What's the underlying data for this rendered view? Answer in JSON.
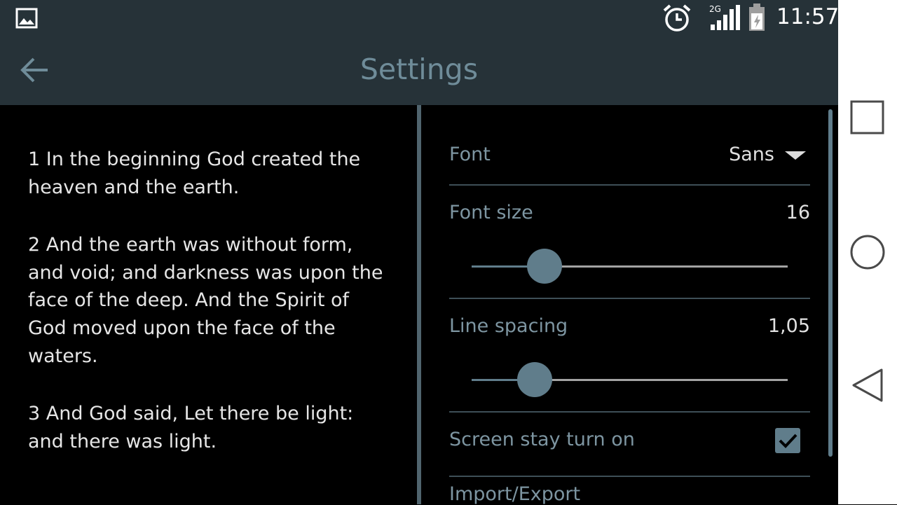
{
  "status_bar": {
    "network_label": "2G",
    "time": "11:57",
    "icons": [
      "image-icon",
      "alarm-icon",
      "signal-icon",
      "battery-charging-icon"
    ]
  },
  "app_bar": {
    "title": "Settings",
    "back_icon": "arrow-back-icon"
  },
  "reader": {
    "verses": [
      "1 In the beginning God created the heaven and the earth.",
      "2 And the earth was without form, and void; and darkness was upon the face of the deep. And the Spirit of God moved upon the face of the waters.",
      "3 And God said, Let there be light: and there was light."
    ]
  },
  "settings": {
    "font": {
      "label": "Font",
      "value": "Sans"
    },
    "font_size": {
      "label": "Font size",
      "value": "16",
      "slider_fraction": 0.23
    },
    "line_spacing": {
      "label": "Line spacing",
      "value": "1,05",
      "slider_fraction": 0.2
    },
    "screen_on": {
      "label": "Screen stay turn on",
      "checked": true
    },
    "import_export": {
      "label": "Import/Export"
    }
  },
  "colors": {
    "bar_background": "#263238",
    "accent": "#607d8b",
    "title_text": "#6f8c99"
  },
  "nav_bar": {
    "icons": [
      "square-recent-icon",
      "circle-home-icon",
      "triangle-back-icon"
    ]
  }
}
